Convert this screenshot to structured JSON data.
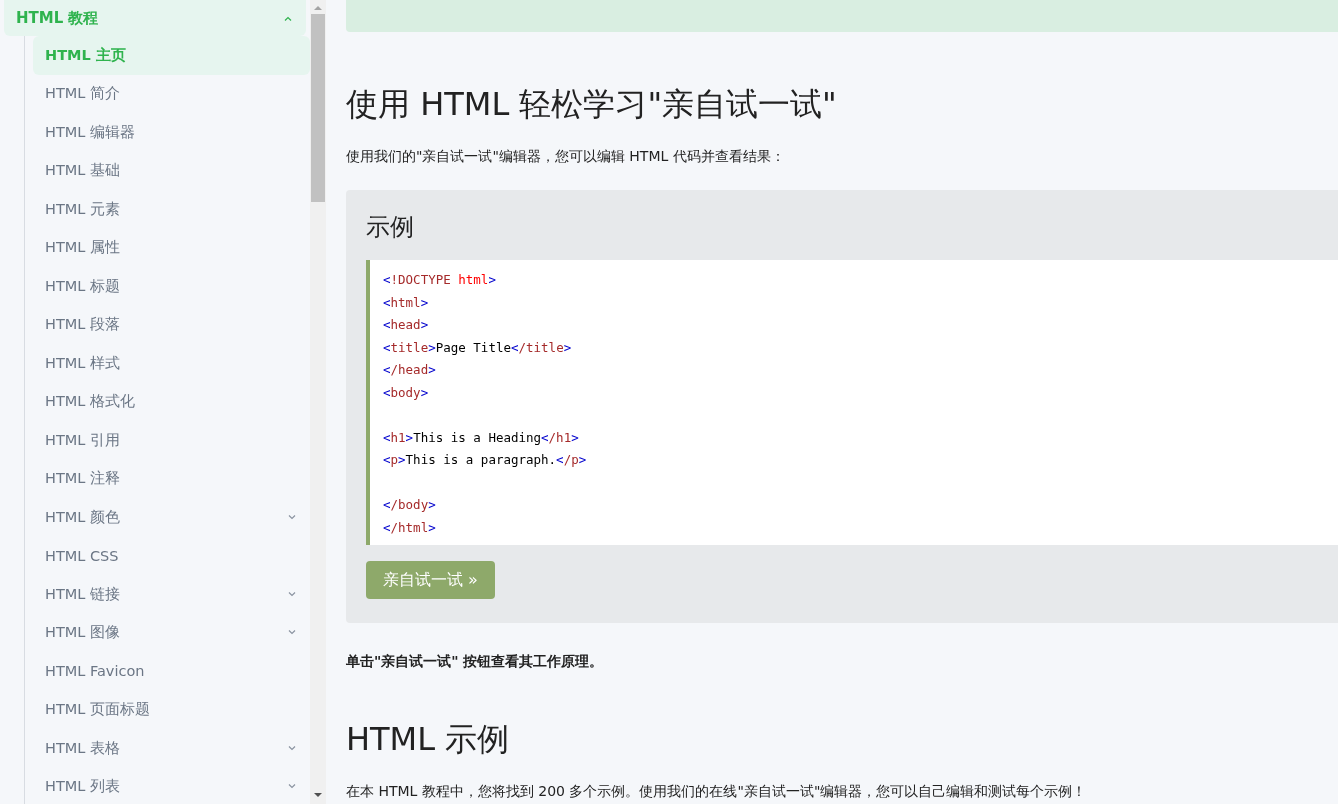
{
  "sidebar": {
    "group": {
      "label": "HTML 教程",
      "expanded": true,
      "items": [
        {
          "label": "HTML 主页",
          "selected": true,
          "expandable": false
        },
        {
          "label": "HTML 简介",
          "selected": false,
          "expandable": false
        },
        {
          "label": "HTML 编辑器",
          "selected": false,
          "expandable": false
        },
        {
          "label": "HTML 基础",
          "selected": false,
          "expandable": false
        },
        {
          "label": "HTML 元素",
          "selected": false,
          "expandable": false
        },
        {
          "label": "HTML 属性",
          "selected": false,
          "expandable": false
        },
        {
          "label": "HTML 标题",
          "selected": false,
          "expandable": false
        },
        {
          "label": "HTML 段落",
          "selected": false,
          "expandable": false
        },
        {
          "label": "HTML 样式",
          "selected": false,
          "expandable": false
        },
        {
          "label": "HTML 格式化",
          "selected": false,
          "expandable": false
        },
        {
          "label": "HTML 引用",
          "selected": false,
          "expandable": false
        },
        {
          "label": "HTML 注释",
          "selected": false,
          "expandable": false
        },
        {
          "label": "HTML 颜色",
          "selected": false,
          "expandable": true
        },
        {
          "label": "HTML CSS",
          "selected": false,
          "expandable": false
        },
        {
          "label": "HTML 链接",
          "selected": false,
          "expandable": true
        },
        {
          "label": "HTML 图像",
          "selected": false,
          "expandable": true
        },
        {
          "label": "HTML Favicon",
          "selected": false,
          "expandable": false
        },
        {
          "label": "HTML 页面标题",
          "selected": false,
          "expandable": false
        },
        {
          "label": "HTML 表格",
          "selected": false,
          "expandable": true
        },
        {
          "label": "HTML 列表",
          "selected": false,
          "expandable": true
        }
      ]
    }
  },
  "content": {
    "heading": "使用 HTML 轻松学习\"亲自试一试\"",
    "intro": "使用我们的\"亲自试一试\"编辑器，您可以编辑 HTML 代码并查看结果：",
    "example": {
      "title": "示例",
      "code": [
        [
          {
            "kind": "bracket",
            "text": "<"
          },
          {
            "kind": "tag",
            "text": "!DOCTYPE"
          },
          {
            "kind": "attr",
            "text": " html"
          },
          {
            "kind": "bracket",
            "text": ">"
          }
        ],
        [
          {
            "kind": "bracket",
            "text": "<"
          },
          {
            "kind": "tag",
            "text": "html"
          },
          {
            "kind": "bracket",
            "text": ">"
          }
        ],
        [
          {
            "kind": "bracket",
            "text": "<"
          },
          {
            "kind": "tag",
            "text": "head"
          },
          {
            "kind": "bracket",
            "text": ">"
          }
        ],
        [
          {
            "kind": "bracket",
            "text": "<"
          },
          {
            "kind": "tag",
            "text": "title"
          },
          {
            "kind": "bracket",
            "text": ">"
          },
          {
            "kind": "text",
            "text": "Page Title"
          },
          {
            "kind": "bracket",
            "text": "<"
          },
          {
            "kind": "tag",
            "text": "/title"
          },
          {
            "kind": "bracket",
            "text": ">"
          }
        ],
        [
          {
            "kind": "bracket",
            "text": "<"
          },
          {
            "kind": "tag",
            "text": "/head"
          },
          {
            "kind": "bracket",
            "text": ">"
          }
        ],
        [
          {
            "kind": "bracket",
            "text": "<"
          },
          {
            "kind": "tag",
            "text": "body"
          },
          {
            "kind": "bracket",
            "text": ">"
          },
          {
            "kind": "blank"
          }
        ],
        [
          {
            "kind": "bracket",
            "text": "<"
          },
          {
            "kind": "tag",
            "text": "h1"
          },
          {
            "kind": "bracket",
            "text": ">"
          },
          {
            "kind": "text",
            "text": "This is a Heading"
          },
          {
            "kind": "bracket",
            "text": "<"
          },
          {
            "kind": "tag",
            "text": "/h1"
          },
          {
            "kind": "bracket",
            "text": ">"
          }
        ],
        [
          {
            "kind": "bracket",
            "text": "<"
          },
          {
            "kind": "tag",
            "text": "p"
          },
          {
            "kind": "bracket",
            "text": ">"
          },
          {
            "kind": "text",
            "text": "This is a paragraph."
          },
          {
            "kind": "bracket",
            "text": "<"
          },
          {
            "kind": "tag",
            "text": "/p"
          },
          {
            "kind": "bracket",
            "text": ">"
          },
          {
            "kind": "blank"
          }
        ],
        [
          {
            "kind": "bracket",
            "text": "<"
          },
          {
            "kind": "tag",
            "text": "/body"
          },
          {
            "kind": "bracket",
            "text": ">"
          }
        ],
        [
          {
            "kind": "bracket",
            "text": "<"
          },
          {
            "kind": "tag",
            "text": "/html"
          },
          {
            "kind": "bracket",
            "text": ">"
          }
        ]
      ],
      "button": "亲自试一试 »"
    },
    "note": "单击\"亲自试一试\" 按钮查看其工作原理。",
    "heading2": "HTML 示例",
    "paragraph": "在本 HTML 教程中，您将找到 200 多个示例。使用我们的在线\"亲自试一试\"编辑器，您可以自己编辑和测试每个示例！"
  }
}
